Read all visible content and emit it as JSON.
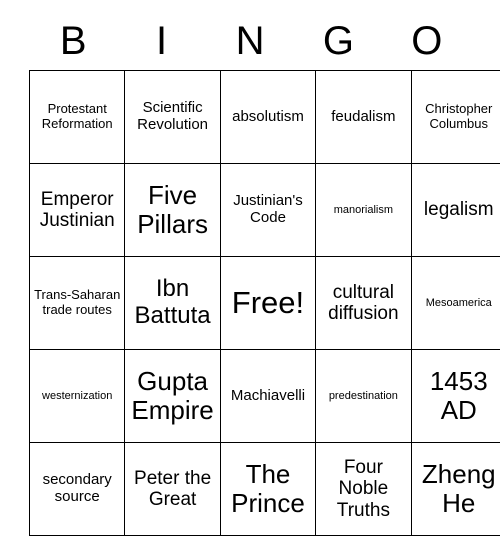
{
  "header": {
    "letters": [
      "B",
      "I",
      "N",
      "G",
      "O"
    ]
  },
  "grid": {
    "rows": 5,
    "columns": 5,
    "cells": [
      [
        {
          "text": "Protestant Reformation",
          "size": "fs-sm"
        },
        {
          "text": "Scientific Revolution",
          "size": "fs-md"
        },
        {
          "text": "absolutism",
          "size": "fs-md"
        },
        {
          "text": "feudalism",
          "size": "fs-md"
        },
        {
          "text": "Christopher Columbus",
          "size": "fs-sm"
        }
      ],
      [
        {
          "text": "Emperor Justinian",
          "size": "fs-lg"
        },
        {
          "text": "Five Pillars",
          "size": "fs-xxl"
        },
        {
          "text": "Justinian's Code",
          "size": "fs-md"
        },
        {
          "text": "manorialism",
          "size": "fs-xs"
        },
        {
          "text": "legalism",
          "size": "fs-lg"
        }
      ],
      [
        {
          "text": "Trans-Saharan trade routes",
          "size": "fs-sm"
        },
        {
          "text": "Ibn Battuta",
          "size": "fs-xl"
        },
        {
          "text": "Free!",
          "size": "fs-free"
        },
        {
          "text": "cultural diffusion",
          "size": "fs-lg"
        },
        {
          "text": "Mesoamerica",
          "size": "fs-xs"
        }
      ],
      [
        {
          "text": "westernization",
          "size": "fs-xs"
        },
        {
          "text": "Gupta Empire",
          "size": "fs-xxl"
        },
        {
          "text": "Machiavelli",
          "size": "fs-md"
        },
        {
          "text": "predestination",
          "size": "fs-xs"
        },
        {
          "text": "1453 AD",
          "size": "fs-xxl"
        }
      ],
      [
        {
          "text": "secondary source",
          "size": "fs-md"
        },
        {
          "text": "Peter the Great",
          "size": "fs-lg"
        },
        {
          "text": "The Prince",
          "size": "fs-xxl"
        },
        {
          "text": "Four Noble Truths",
          "size": "fs-lg"
        },
        {
          "text": "Zheng He",
          "size": "fs-xxl"
        }
      ]
    ]
  },
  "colors": {
    "background": "#ffffff",
    "text": "#000000",
    "border": "#000000"
  }
}
